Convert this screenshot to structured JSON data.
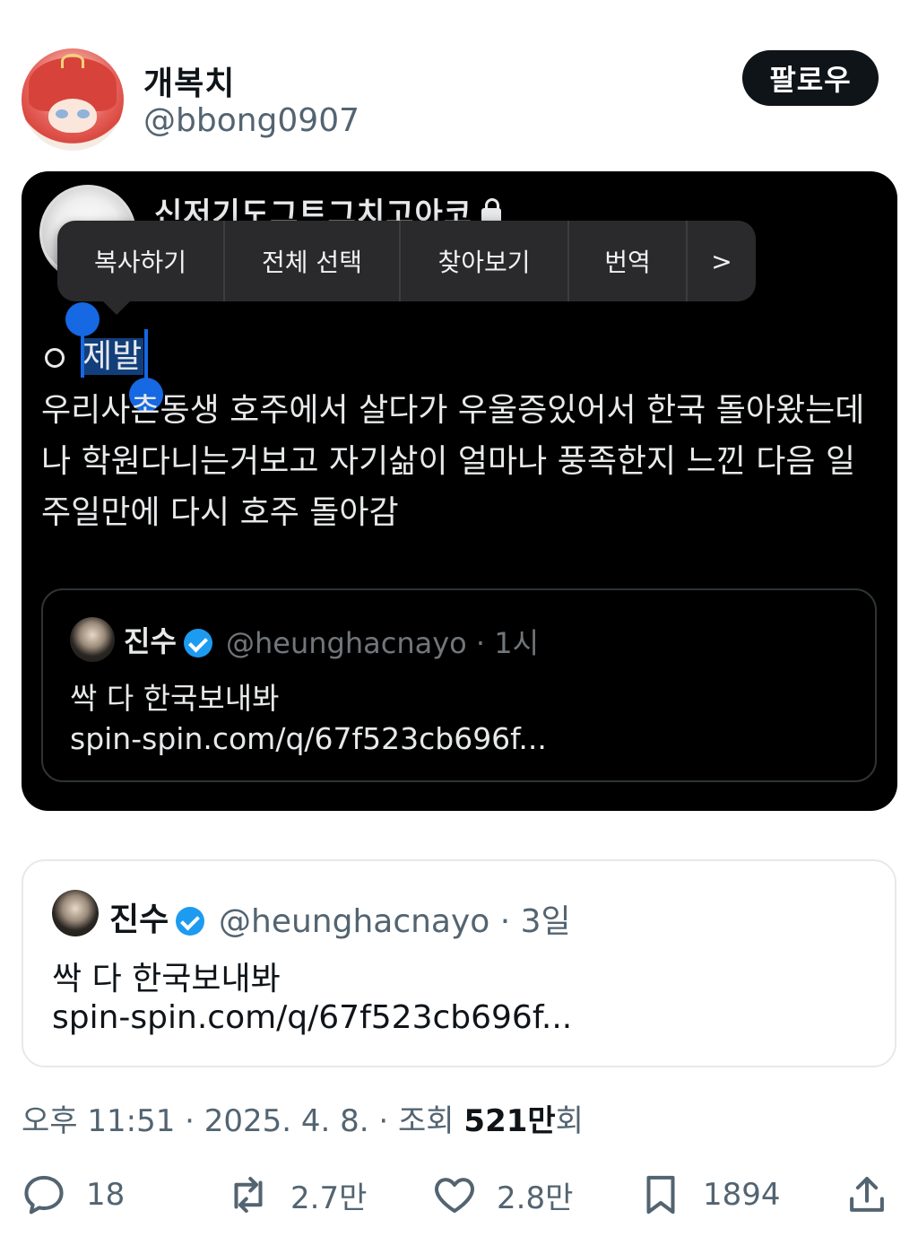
{
  "author": {
    "display_name": "개복치",
    "handle": "@bbong0907",
    "follow_label": "팔로우"
  },
  "screenshot": {
    "account_name": "신저기도그트그치고아코",
    "context_menu": [
      "복사하기",
      "전체 선택",
      "찾아보기",
      "번역",
      ">"
    ],
    "first_line_prefix": "",
    "selected_text": "제발",
    "body": "우리사촌동생 호주에서 살다가 우울증있어서 한국 돌아왔는데 나 학원다니는거보고 자기삶이 얼마나 풍족한지 느낀 다음 일주일만에 다시 호주 돌아감",
    "quote": {
      "name": "진수",
      "meta": "@heunghacnayo · 1시",
      "text": "싹 다 한국보내봐",
      "link": "spin-spin.com/q/67f523cb696f..."
    }
  },
  "quote": {
    "name": "진수",
    "meta": "@heunghacnayo · 3일",
    "text": "싹 다 한국보내봐",
    "link": "spin-spin.com/q/67f523cb696f..."
  },
  "timestamp": {
    "prefix": "오후 11:51 · 2025. 4. 8. · 조회 ",
    "views_num": "521만",
    "suffix": "회"
  },
  "actions": {
    "replies": "18",
    "retweets": "2.7만",
    "likes": "2.8만",
    "bookmarks": "1894"
  },
  "icons": {
    "reply": "reply-icon",
    "retweet": "retweet-icon",
    "like": "heart-icon",
    "bookmark": "bookmark-icon",
    "share": "share-icon",
    "verified": "verified-badge-icon",
    "lock": "lock-icon"
  },
  "colors": {
    "accent": "#1d9bf0",
    "selection": "#1668e3",
    "text_secondary": "#536471"
  }
}
